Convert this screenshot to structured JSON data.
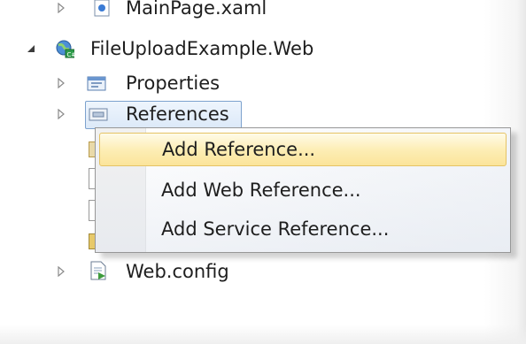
{
  "solution_tree": {
    "items": [
      {
        "label": "MainPage.xaml",
        "icon": "xaml-file-icon",
        "expander": "collapsed"
      },
      {
        "label": "FileUploadExample.Web",
        "icon": "web-project-icon",
        "expander": "expanded"
      },
      {
        "label": "Properties",
        "icon": "properties-icon",
        "expander": "collapsed"
      },
      {
        "label": "References",
        "icon": "references-folder-icon",
        "expander": "collapsed"
      },
      {
        "label": "Web.config",
        "icon": "config-file-icon",
        "expander": "collapsed"
      }
    ]
  },
  "context_menu": {
    "items": [
      {
        "label": "Add Reference...",
        "highlighted": true
      },
      {
        "label": "Add Web Reference...",
        "highlighted": false
      },
      {
        "label": "Add Service Reference...",
        "highlighted": false
      }
    ]
  },
  "colors": {
    "selection_border": "#7da2ce",
    "highlight_fill": "#fdeeb6",
    "highlight_border": "#e5c365",
    "text": "#1e1e1e"
  }
}
